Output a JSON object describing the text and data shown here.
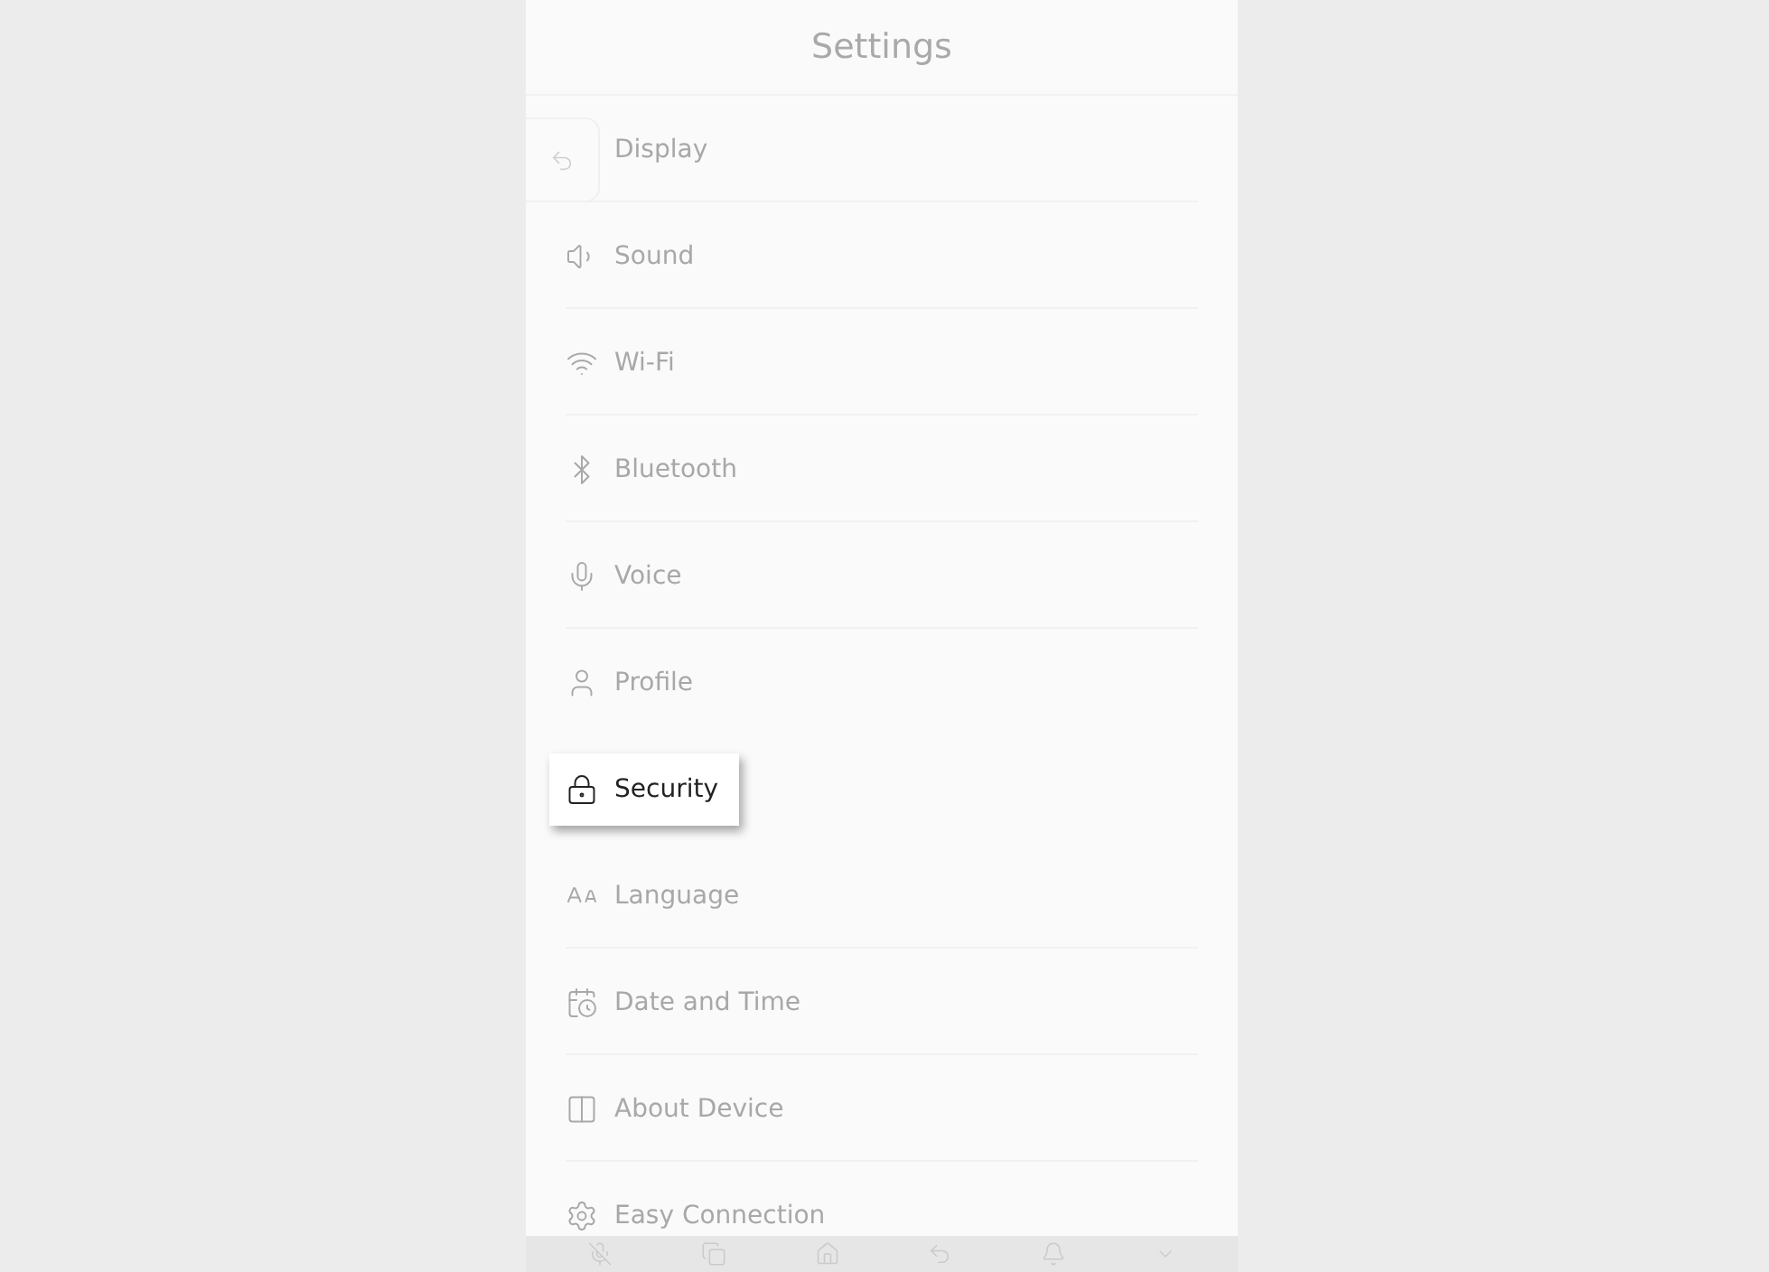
{
  "header": {
    "title": "Settings"
  },
  "items": [
    {
      "label": "Display",
      "selected": false
    },
    {
      "label": "Sound",
      "selected": false
    },
    {
      "label": "Wi-Fi",
      "selected": false
    },
    {
      "label": "Bluetooth",
      "selected": false
    },
    {
      "label": "Voice",
      "selected": false
    },
    {
      "label": "Profile",
      "selected": false
    },
    {
      "label": "Security",
      "selected": true
    },
    {
      "label": "Language",
      "selected": false
    },
    {
      "label": "Date and Time",
      "selected": false
    },
    {
      "label": "About Device",
      "selected": false
    },
    {
      "label": "Easy Connection",
      "selected": false
    }
  ]
}
